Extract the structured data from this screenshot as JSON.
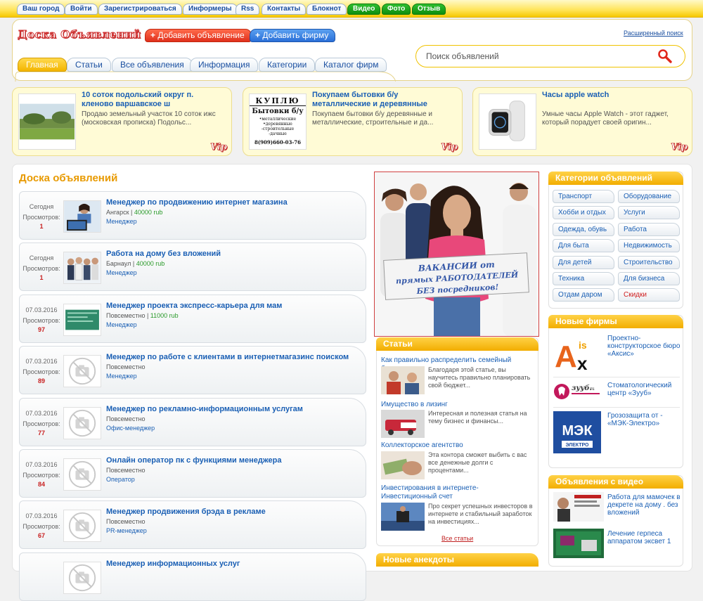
{
  "topnav": {
    "links": [
      "Ваш город",
      "Войти",
      "Зарегистрироваться",
      "Информеры",
      "Rss",
      "Контакты",
      "Блокнот"
    ],
    "green_links": [
      "Видео",
      "Фото",
      "Отзыв"
    ]
  },
  "header": {
    "logo": "Доска Объявлений",
    "add_ad": "Добавить объявление",
    "add_firm": "Добавить фирму",
    "advanced_search": "Расширенный поиск",
    "search_placeholder": "Поиск объявлений"
  },
  "tabs": [
    "Главная",
    "Статьи",
    "Все объявления",
    "Информация",
    "Категории",
    "Каталог фирм"
  ],
  "vip": [
    {
      "title": "10 соток подольский округ п. кленово варшавское ш",
      "desc": "Продаю земельный участок 10 соток ижс (московская прописка) Подольс...",
      "badge": "Vip"
    },
    {
      "title": "Покупаем бытовки б/у металлические и деревянные",
      "desc": "Покупаем бытовки б/у деревянные и металлические, строительные и да...",
      "badge": "Vip",
      "sign": {
        "head": "КУПЛЮ",
        "sub": "Бытовки б/у",
        "items": [
          "•металлические",
          "•деревянные",
          "-строительные",
          "-дачные"
        ],
        "phone": "8(909)660-03-76"
      }
    },
    {
      "title": "Часы apple watch",
      "desc": "Умные часы Apple Watch - этот гаджет, который порадует своей оригин...",
      "badge": "Vip"
    }
  ],
  "main": {
    "title": "Доска объявлений",
    "views_label": "Просмотров:",
    "listings": [
      {
        "date": "Сегодня",
        "views": "1",
        "title": "Менеджер по продвижению интернет магазина",
        "city": "Ангарск",
        "price": "40000 rub",
        "category": "Менеджер",
        "img": "laptop"
      },
      {
        "date": "Сегодня",
        "views": "1",
        "title": "Работа на дому без вложений",
        "city": "Барнаул",
        "price": "40000 rub",
        "category": "Менеджер",
        "img": "people"
      },
      {
        "date": "07.03.2016",
        "views": "97",
        "title": "Менеджер проекта экспресс-карьера для мам",
        "city": "Повсеместно",
        "price": "11000 rub",
        "category": "Менеджер",
        "img": "green"
      },
      {
        "date": "07.03.2016",
        "views": "89",
        "title": "Менеджер по работе с клиентами в интернетмагазинс поиском",
        "city": "Повсеместно",
        "price": "",
        "category": "Менеджер",
        "img": "none"
      },
      {
        "date": "07.03.2016",
        "views": "77",
        "title": "Менеджер по рекламно-информационным услугам",
        "city": "Повсеместно",
        "price": "",
        "category": "Офис-менеджер",
        "img": "none"
      },
      {
        "date": "07.03.2016",
        "views": "84",
        "title": "Онлайн оператор пк с функциями менеджера",
        "city": "Повсеместно",
        "price": "",
        "category": "Оператор",
        "img": "none"
      },
      {
        "date": "07.03.2016",
        "views": "67",
        "title": "Менеджер продвижения брэда в рекламе",
        "city": "Повсеместно",
        "price": "",
        "category": "PR-менеджер",
        "img": "none"
      },
      {
        "date": "",
        "views": "",
        "title": "Менеджер информационных услуг",
        "city": "",
        "price": "",
        "category": "",
        "img": "none"
      }
    ]
  },
  "banner": {
    "lines": [
      "ВАКАНСИИ от",
      "прямых РАБОТОДАТЕЛЕЙ",
      "БЕЗ посредников!"
    ]
  },
  "articles": {
    "title": "Статьи",
    "items": [
      {
        "title": "Как правильно распределить семейный бюджет",
        "desc": "Благодаря этой статье, вы научитесь правильно планировать свой бюджет..."
      },
      {
        "title": "Имущество в лизинг",
        "desc": "Интересная и полезная статья на тему бизнес и финансы..."
      },
      {
        "title": "Коллекторское агентство",
        "desc": "Эта контора сможет выбить с вас все денежные долги с процентами..."
      },
      {
        "title": "Инвестирования в интернете- Инвестиционный счет",
        "desc": "Про секрет успешных инвесторов в интернете и стабильный заработок на инвестициях..."
      }
    ],
    "all": "Все статьи",
    "next_title": "Новые анекдоты"
  },
  "categories": {
    "title": "Категории объявлений",
    "items": [
      "Транспорт",
      "Оборудование",
      "Хобби и отдых",
      "Услуги",
      "Одежда, обувь",
      "Работа",
      "Для быта",
      "Недвижимость",
      "Для детей",
      "Строительство",
      "Техника",
      "Для бизнеса",
      "Отдам даром",
      "Скидки"
    ]
  },
  "firms": {
    "title": "Новые фирмы",
    "items": [
      {
        "name": "Проектно-конструкторское бюро «Аксис»",
        "logo_text": "Ax"
      },
      {
        "name": "Стоматологический центр «Зууб»",
        "logo_text": "зууб.ru"
      },
      {
        "name": "Грозозащита от - «МЭК-Электро»",
        "logo_text": "МЭК"
      }
    ]
  },
  "video": {
    "title": "Объявления с видео",
    "items": [
      "Работа для мамочек в декрете на дому . без вложений",
      "Лечение герпеса аппаратом эксвет 1"
    ]
  },
  "colors": {
    "accent": "#f2ad00",
    "link": "#1a5fb4",
    "price": "#2a9a2a",
    "views": "#c82020"
  }
}
